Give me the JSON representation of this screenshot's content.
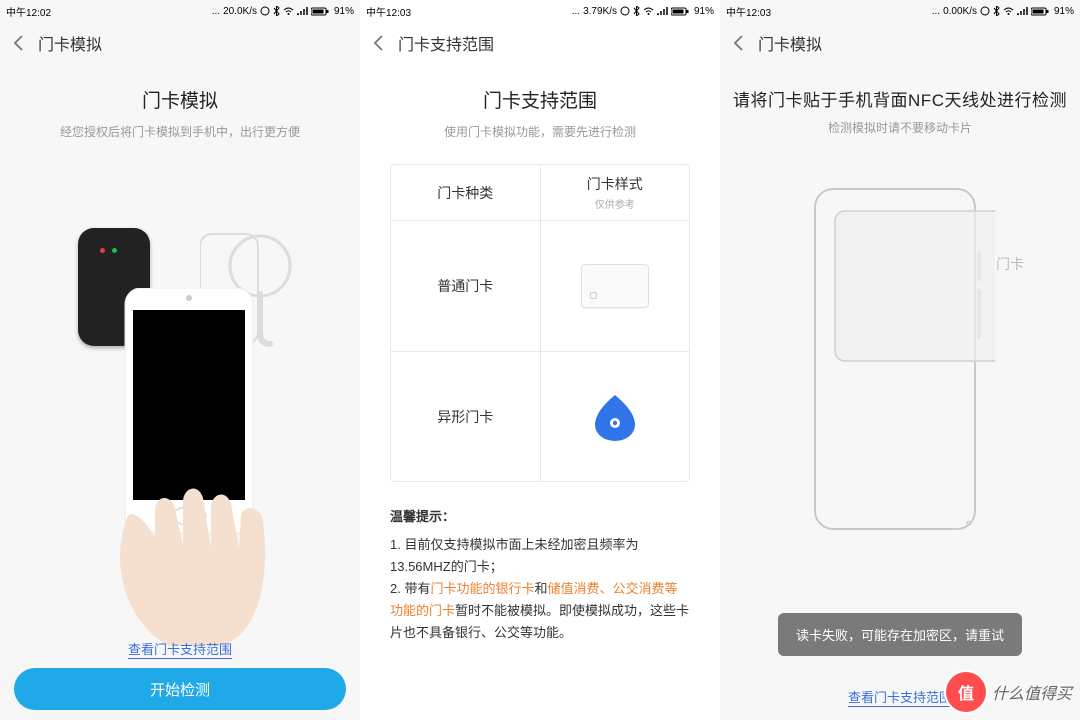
{
  "statusbar": {
    "time1": "中午12:02",
    "speed1": "20.0K/s",
    "bat": "91%",
    "time2": "中午12:03",
    "speed2": "3.79K/s",
    "time3": "中午12:03",
    "speed3": "0.00K/s"
  },
  "screen1": {
    "nav_title": "门卡模拟",
    "title": "门卡模拟",
    "subtitle": "经您授权后将门卡模拟到手机中，出行更方便",
    "link": "查看门卡支持范围",
    "button": "开始检测"
  },
  "screen2": {
    "nav_title": "门卡支持范围",
    "title": "门卡支持范围",
    "subtitle": "使用门卡模拟功能，需要先进行检测",
    "head_col1": "门卡种类",
    "head_col2": "门卡样式",
    "head_col2_note": "仅供参考",
    "row1": "普通门卡",
    "row2": "异形门卡",
    "tips_head": "温馨提示：",
    "tip1": "1. 目前仅支持模拟市面上未经加密且频率为13.56MHZ的门卡；",
    "tip2a": "2. 带有",
    "tip2b": "门卡功能的银行卡",
    "tip2c": "和",
    "tip2d": "储值消费、公交消费等功能的门卡",
    "tip2e": "暂时不能被模拟。即使模拟成功，这些卡片也不具备银行、公交等功能。"
  },
  "screen3": {
    "nav_title": "门卡模拟",
    "title": "请将门卡贴于手机背面NFC天线处进行检测",
    "subtitle": "检测模拟时请不要移动卡片",
    "nfc_label": "门卡",
    "toast": "读卡失败，可能存在加密区，请重试",
    "link": "查看门卡支持范围"
  },
  "watermark": {
    "badge": "值",
    "text": "什么值得买"
  }
}
